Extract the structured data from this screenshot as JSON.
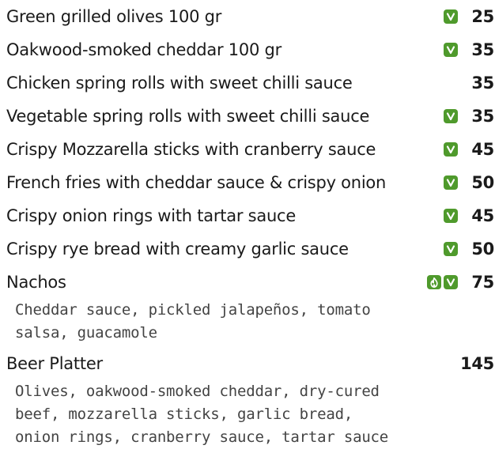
{
  "colors": {
    "badge_green": "#4f9a2c"
  },
  "items": [
    {
      "name": "Green grilled olives 100 gr",
      "price": "25",
      "icons": [
        "vegetarian-icon"
      ]
    },
    {
      "name": "Oakwood-smoked cheddar 100 gr",
      "price": "35",
      "icons": [
        "vegetarian-icon"
      ]
    },
    {
      "name": "Chicken spring rolls with sweet chilli sauce",
      "price": "35",
      "icons": []
    },
    {
      "name": "Vegetable spring rolls with sweet chilli sauce",
      "price": "35",
      "icons": [
        "vegetarian-icon"
      ]
    },
    {
      "name": "Crispy Mozzarella sticks with cranberry sauce",
      "price": "45",
      "icons": [
        "vegetarian-icon"
      ]
    },
    {
      "name": "French fries with cheddar sauce & crispy onion",
      "price": "50",
      "icons": [
        "vegetarian-icon"
      ]
    },
    {
      "name": "Crispy onion rings with tartar sauce",
      "price": "45",
      "icons": [
        "vegetarian-icon"
      ]
    },
    {
      "name": "Crispy rye bread with creamy garlic sauce",
      "price": "50",
      "icons": [
        "vegetarian-icon"
      ]
    },
    {
      "name": "Nachos",
      "price": "75",
      "icons": [
        "spicy-icon",
        "vegetarian-icon"
      ],
      "description": "Cheddar sauce, pickled jalapeños, tomato\nsalsa, guacamole"
    },
    {
      "name": "Beer Platter",
      "price": "145",
      "icons": [],
      "description": "Olives, oakwood-smoked cheddar, dry-cured\nbeef, mozzarella sticks, garlic bread,\nonion rings, cranberry sauce, tartar sauce"
    }
  ]
}
